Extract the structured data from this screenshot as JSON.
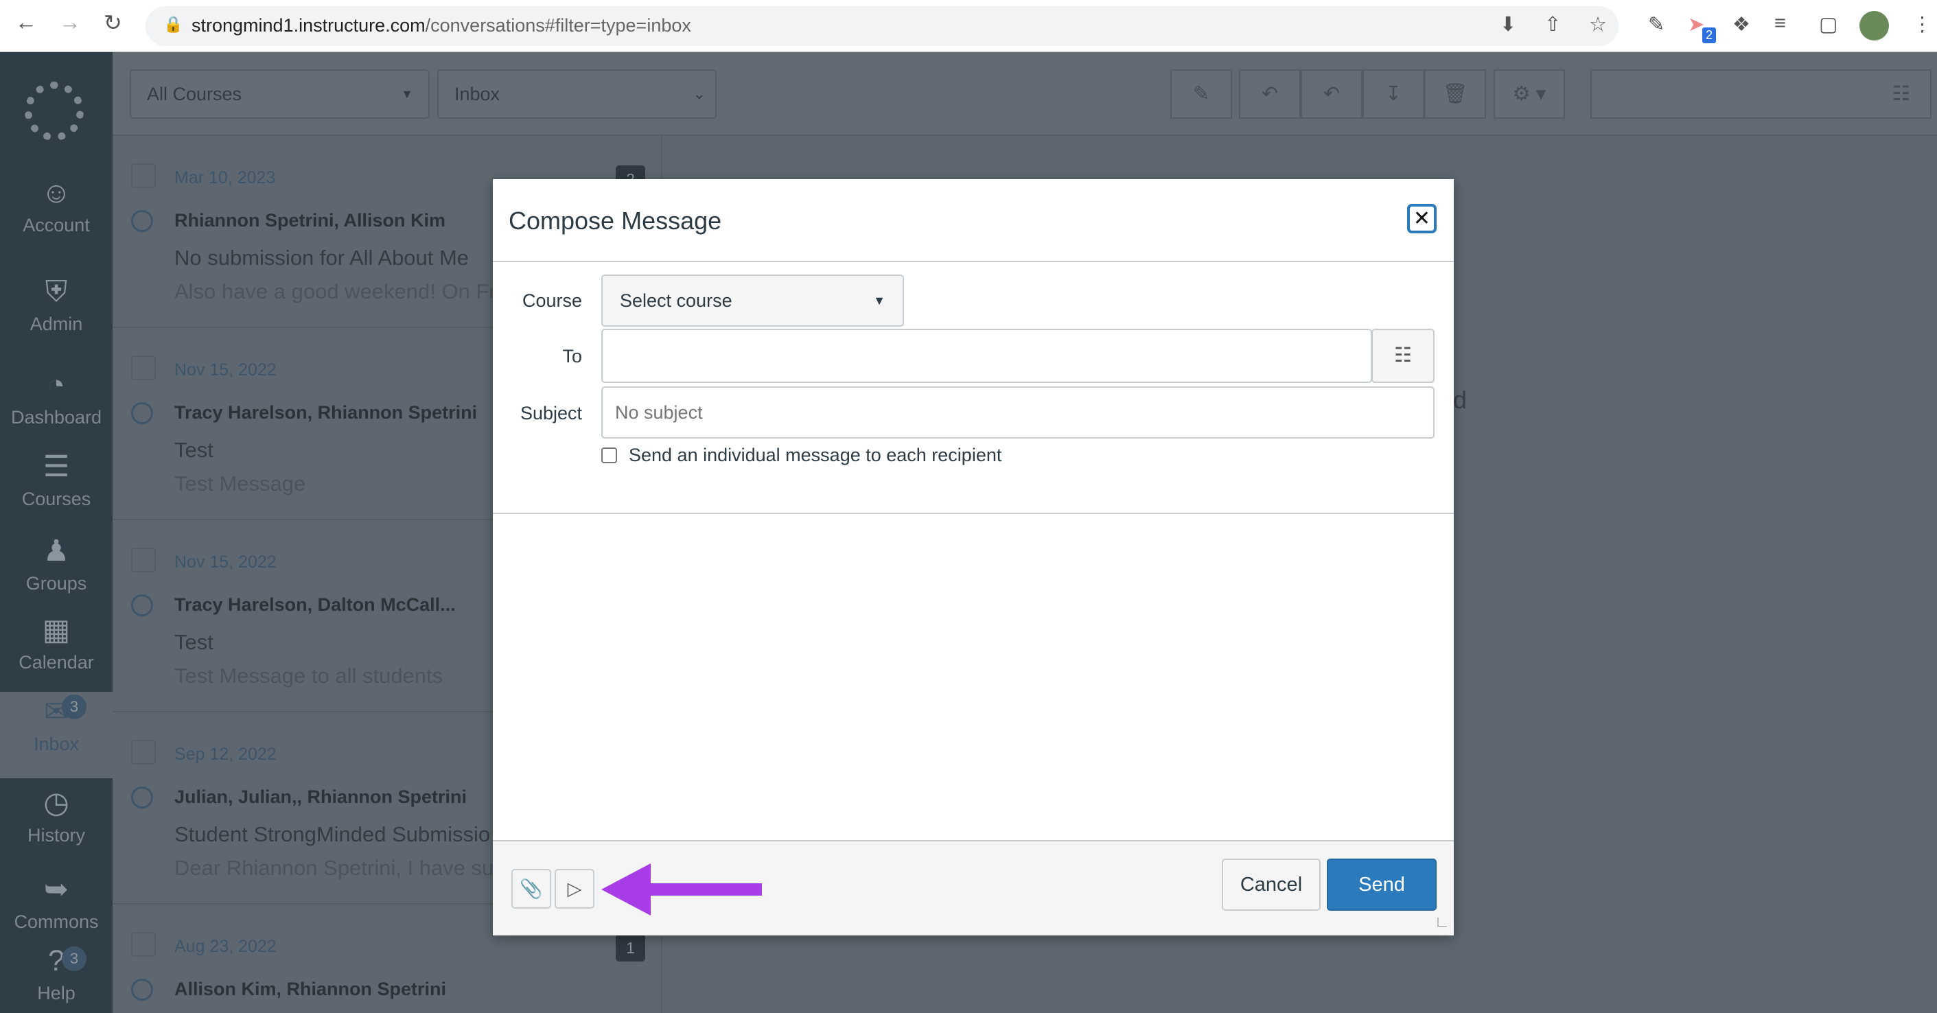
{
  "browser": {
    "url_host": "strongmind1.instructure.com",
    "url_path": "/conversations#filter=type=inbox",
    "ext_badge": "2"
  },
  "sidebar": {
    "items": [
      {
        "label": "Account",
        "icon": "avatar"
      },
      {
        "label": "Admin",
        "icon": "shield-key"
      },
      {
        "label": "Dashboard",
        "icon": "speedometer"
      },
      {
        "label": "Courses",
        "icon": "book"
      },
      {
        "label": "Groups",
        "icon": "people"
      },
      {
        "label": "Calendar",
        "icon": "calendar"
      },
      {
        "label": "Inbox",
        "icon": "inbox",
        "badge": "3",
        "active": true
      },
      {
        "label": "History",
        "icon": "clock"
      },
      {
        "label": "Commons",
        "icon": "commons-arrow"
      },
      {
        "label": "Help",
        "icon": "question",
        "badge": "3"
      }
    ]
  },
  "toolbar": {
    "course_filter": "All Courses",
    "mailbox_filter": "Inbox"
  },
  "conversations": [
    {
      "date": "Mar 10, 2023",
      "participants": "Rhiannon Spetrini, Allison Kim",
      "subject": "No submission for All About Me",
      "preview": "Also have a good weekend! On Fr",
      "count": "2"
    },
    {
      "date": "Nov 15, 2022",
      "participants": "Tracy Harelson, Rhiannon Spetrini",
      "subject": "Test",
      "preview": "Test Message",
      "count": ""
    },
    {
      "date": "Nov 15, 2022",
      "participants": "Tracy Harelson, Dalton McCall...",
      "subject": "Test",
      "preview": "Test Message to all students",
      "count": ""
    },
    {
      "date": "Sep 12, 2022",
      "participants": "Julian, Julian,, Rhiannon Spetrini",
      "subject": "Student StrongMinded Submissio",
      "preview": "Dear Rhiannon Spetrini, I have su",
      "count": ""
    },
    {
      "date": "Aug 23, 2022",
      "participants": "Allison Kim, Rhiannon Spetrini",
      "subject": "",
      "preview": "",
      "count": "1"
    }
  ],
  "modal": {
    "title": "Compose Message",
    "course_label": "Course",
    "course_value": "Select course",
    "to_label": "To",
    "to_value": "",
    "subject_label": "Subject",
    "subject_placeholder": "No subject",
    "individual_label": "Send an individual message to each recipient",
    "cancel": "Cancel",
    "send": "Send"
  },
  "annotation": {
    "arrow_color": "#a83de8"
  },
  "colors": {
    "send": "#2b7abc",
    "sidebar": "#2f3d47"
  }
}
